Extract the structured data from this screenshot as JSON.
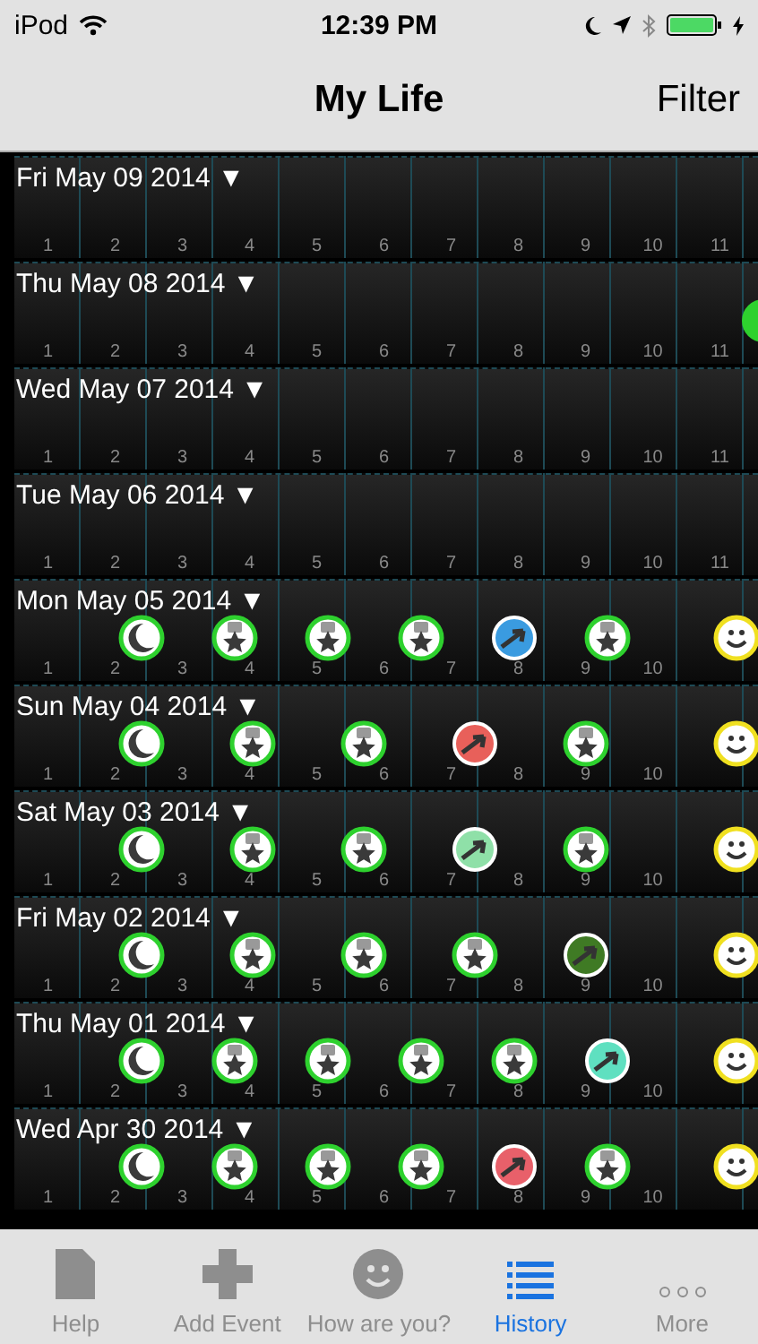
{
  "status_bar": {
    "carrier": "iPod",
    "time": "12:39 PM"
  },
  "nav": {
    "title": "My Life",
    "filter": "Filter"
  },
  "days": [
    {
      "label": "Fri May 09 2014 ▼",
      "hours": [
        "1",
        "2",
        "3",
        "4",
        "5",
        "6",
        "7",
        "8",
        "9",
        "10",
        "11"
      ]
    },
    {
      "label": "Thu May 08 2014 ▼",
      "hours": [
        "1",
        "2",
        "3",
        "4",
        "5",
        "6",
        "7",
        "8",
        "9",
        "10",
        "11"
      ],
      "events": [
        {
          "kind": "edge"
        }
      ]
    },
    {
      "label": "Wed May 07 2014 ▼",
      "hours": [
        "1",
        "2",
        "3",
        "4",
        "5",
        "6",
        "7",
        "8",
        "9",
        "10",
        "11"
      ]
    },
    {
      "label": "Tue May 06 2014 ▼",
      "hours": [
        "1",
        "2",
        "3",
        "4",
        "5",
        "6",
        "7",
        "8",
        "9",
        "10",
        "11"
      ]
    },
    {
      "label": "Mon May 05 2014 ▼",
      "hours": [
        "1",
        "2",
        "3",
        "4",
        "5",
        "6",
        "7",
        "8",
        "9",
        "10"
      ],
      "events": [
        {
          "kind": "moon"
        },
        {
          "kind": "meal"
        },
        {
          "kind": "meal"
        },
        {
          "kind": "meal"
        },
        {
          "kind": "arrow",
          "color": "#3a9be0"
        },
        {
          "kind": "meal"
        },
        {
          "kind": "cluster"
        }
      ]
    },
    {
      "label": "Sun May 04 2014 ▼",
      "hours": [
        "1",
        "2",
        "3",
        "4",
        "5",
        "6",
        "7",
        "8",
        "9",
        "10"
      ],
      "events": [
        {
          "kind": "moon"
        },
        {
          "kind": "meal"
        },
        {
          "kind": "meal"
        },
        {
          "kind": "arrow",
          "color": "#e8605a"
        },
        {
          "kind": "meal"
        },
        {
          "kind": "cluster"
        }
      ]
    },
    {
      "label": "Sat May 03 2014 ▼",
      "hours": [
        "1",
        "2",
        "3",
        "4",
        "5",
        "6",
        "7",
        "8",
        "9",
        "10"
      ],
      "events": [
        {
          "kind": "moon"
        },
        {
          "kind": "meal"
        },
        {
          "kind": "meal"
        },
        {
          "kind": "arrow",
          "color": "#8fe0a8"
        },
        {
          "kind": "meal"
        },
        {
          "kind": "cluster"
        }
      ]
    },
    {
      "label": "Fri May 02 2014 ▼",
      "hours": [
        "1",
        "2",
        "3",
        "4",
        "5",
        "6",
        "7",
        "8",
        "9",
        "10"
      ],
      "events": [
        {
          "kind": "moon"
        },
        {
          "kind": "meal"
        },
        {
          "kind": "meal"
        },
        {
          "kind": "meal"
        },
        {
          "kind": "arrow",
          "color": "#3f7a24"
        },
        {
          "kind": "cluster"
        }
      ]
    },
    {
      "label": "Thu May 01 2014 ▼",
      "hours": [
        "1",
        "2",
        "3",
        "4",
        "5",
        "6",
        "7",
        "8",
        "9",
        "10"
      ],
      "events": [
        {
          "kind": "moon"
        },
        {
          "kind": "meal"
        },
        {
          "kind": "meal"
        },
        {
          "kind": "meal"
        },
        {
          "kind": "meal"
        },
        {
          "kind": "arrow",
          "color": "#5fe0c0"
        },
        {
          "kind": "cluster"
        }
      ]
    },
    {
      "label": "Wed Apr 30 2014 ▼",
      "hours": [
        "1",
        "2",
        "3",
        "4",
        "5",
        "6",
        "7",
        "8",
        "9",
        "10"
      ],
      "events": [
        {
          "kind": "moon"
        },
        {
          "kind": "meal"
        },
        {
          "kind": "meal"
        },
        {
          "kind": "meal"
        },
        {
          "kind": "arrow",
          "color": "#e8606a"
        },
        {
          "kind": "meal"
        },
        {
          "kind": "cluster"
        }
      ]
    }
  ],
  "tabs": [
    {
      "label": "Help",
      "kind": "page",
      "selected": false
    },
    {
      "label": "Add Event",
      "kind": "plus",
      "selected": false
    },
    {
      "label": "How are you?",
      "kind": "smile",
      "selected": false
    },
    {
      "label": "History",
      "kind": "list",
      "selected": true
    },
    {
      "label": "More",
      "kind": "dots",
      "selected": false
    }
  ]
}
